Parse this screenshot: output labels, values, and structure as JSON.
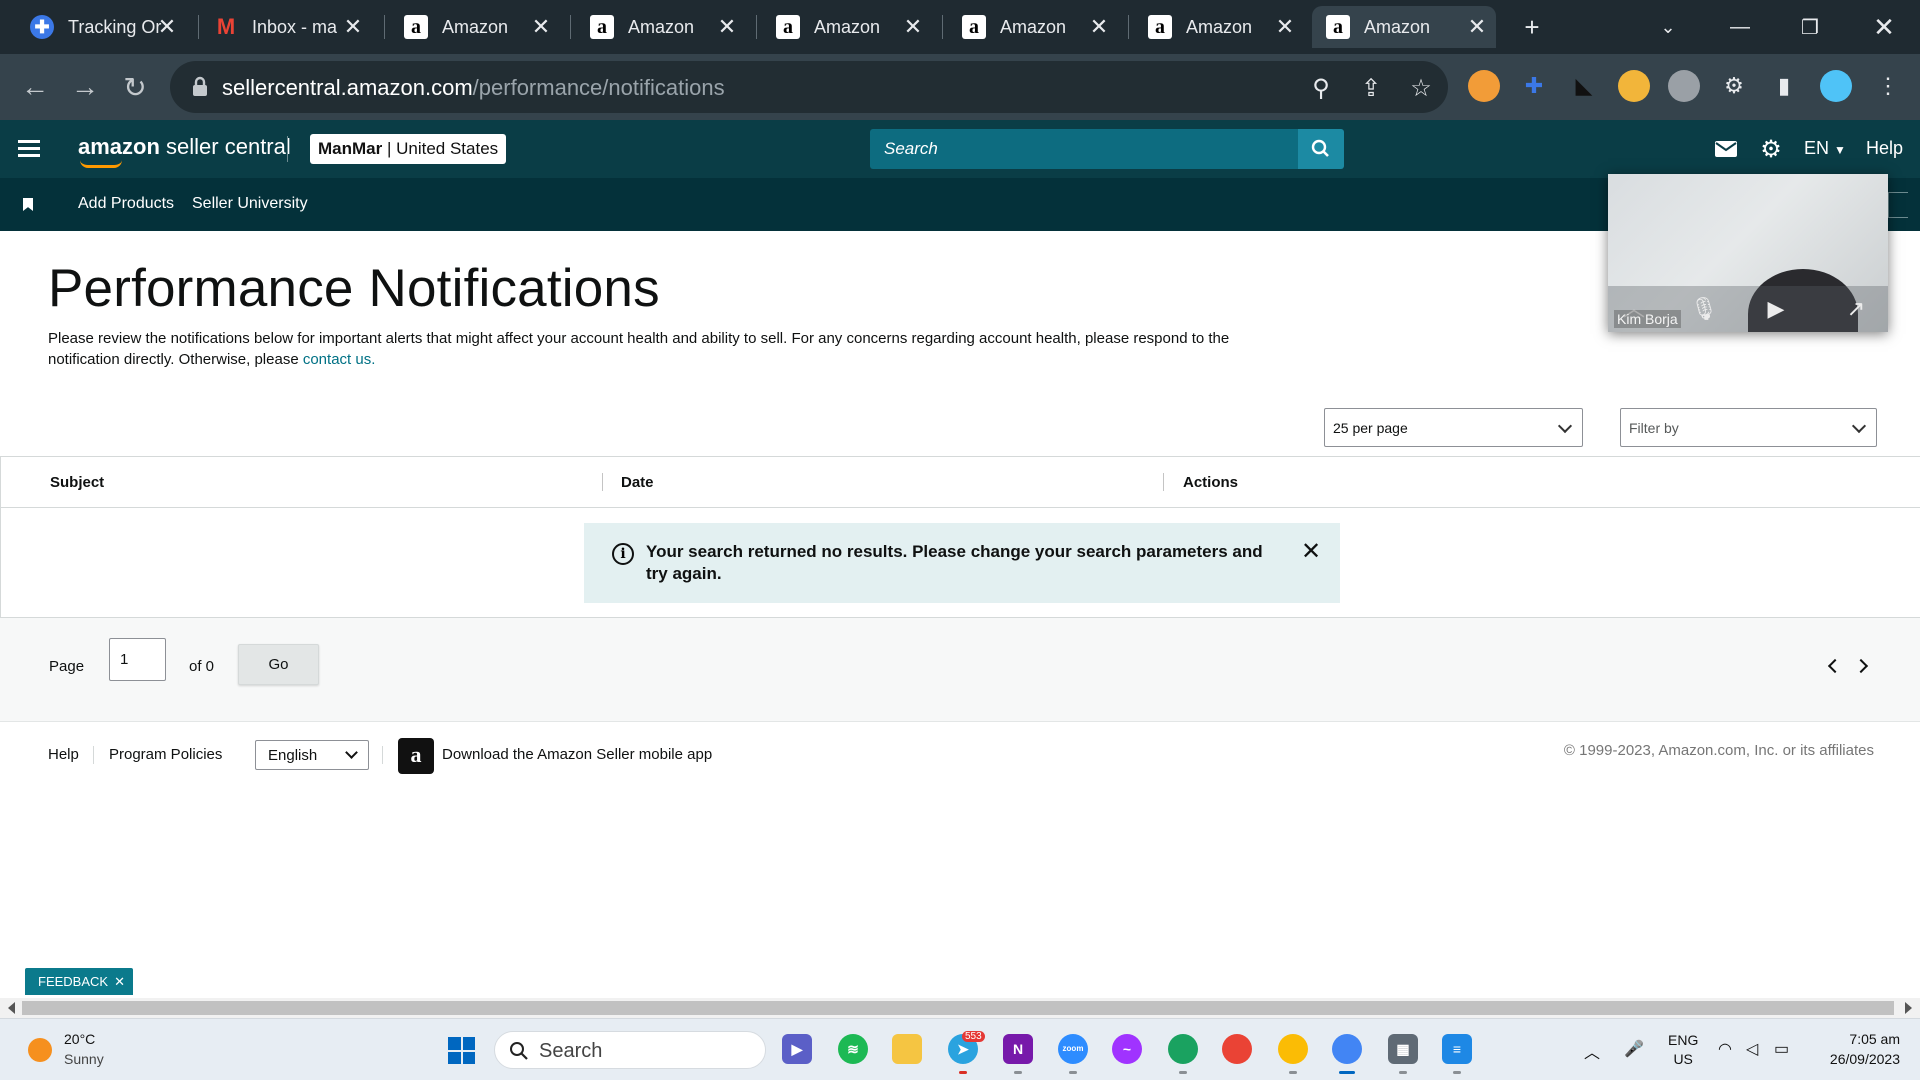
{
  "browser": {
    "tabs": [
      {
        "title": "Tracking Or",
        "icon": "plus-circle-icon"
      },
      {
        "title": "Inbox - ma",
        "icon": "gmail-icon"
      },
      {
        "title": "Amazon",
        "icon": "amazon-icon"
      },
      {
        "title": "Amazon",
        "icon": "amazon-icon"
      },
      {
        "title": "Amazon",
        "icon": "amazon-icon"
      },
      {
        "title": "Amazon",
        "icon": "amazon-icon"
      },
      {
        "title": "Amazon",
        "icon": "amazon-icon"
      },
      {
        "title": "Amazon",
        "icon": "amazon-icon",
        "active": true
      }
    ],
    "url_host": "sellercentral.amazon.com",
    "url_path": "/performance/notifications"
  },
  "header": {
    "logo_brand": "amazon",
    "logo_product": " seller central",
    "account_name": "ManMar",
    "account_region": " | United States",
    "search_placeholder": "Search",
    "language": "EN",
    "help": "Help"
  },
  "subnav": {
    "links": [
      "Add Products",
      "Seller University"
    ]
  },
  "page": {
    "title": "Performance Notifications",
    "intro": "Please review the notifications below for important alerts that might affect your account health and ability to sell. For any concerns regarding account health, please respond to the notification directly. Otherwise, please ",
    "contact_link": "contact us.",
    "per_page": "25 per page",
    "filter_by": "Filter by"
  },
  "table": {
    "columns": [
      "Subject",
      "Date",
      "Actions"
    ],
    "rows": [],
    "no_results": "Your search returned no results. Please change your search parameters and try again."
  },
  "pager": {
    "page_label": "Page",
    "page_value": "1",
    "of_label": "of 0",
    "go_label": "Go"
  },
  "footer": {
    "help": "Help",
    "program_policies": "Program Policies",
    "language": "English",
    "download_app": "Download the Amazon Seller mobile app",
    "copyright": "© 1999-2023, Amazon.com, Inc. or its affiliates"
  },
  "feedback": {
    "label": "FEEDBACK"
  },
  "video_call": {
    "participant": "Kim Borja"
  },
  "taskbar": {
    "weather_temp": "20°C",
    "weather_desc": "Sunny",
    "search_label": "Search",
    "telegram_badge": "553",
    "lang_line1": "ENG",
    "lang_line2": "US",
    "time": "7:05 am",
    "date": "26/09/2023"
  },
  "colors": {
    "header_bg": "#0a3d46",
    "subnav_bg": "#04313a",
    "search_bg": "#0d6c80",
    "link": "#007185",
    "alert_bg": "#e3f0f1",
    "feedback_bg": "#0b7a8c"
  }
}
